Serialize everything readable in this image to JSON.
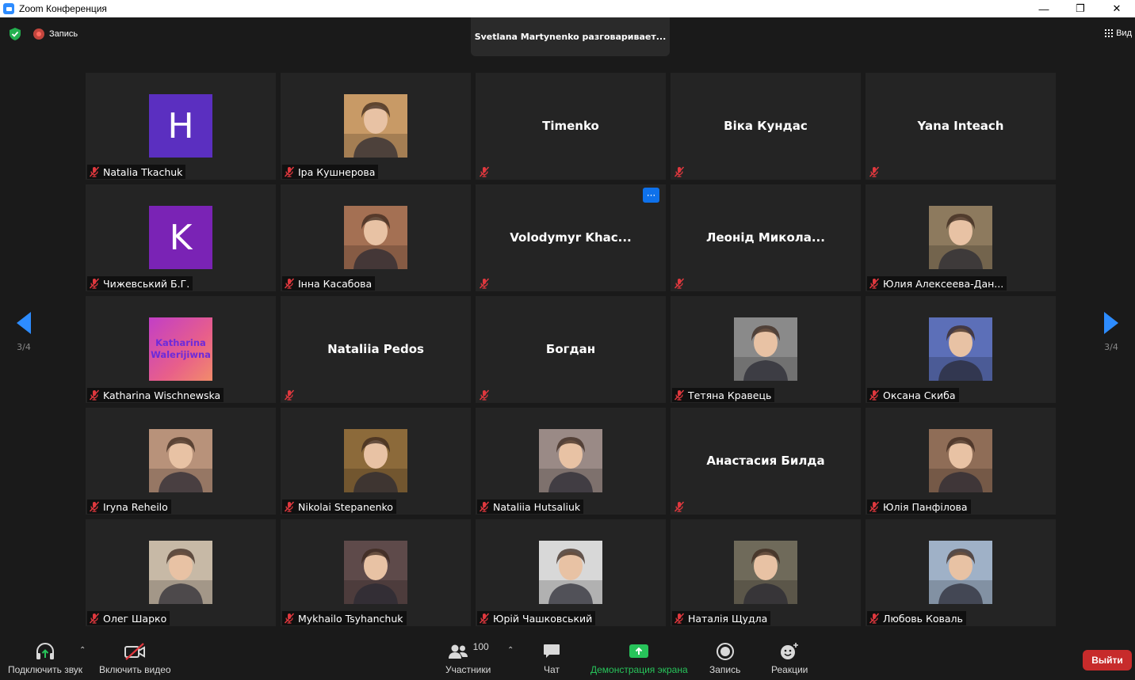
{
  "window": {
    "title": "Zoom Конференция",
    "minimize": "—",
    "restore": "❐",
    "close": "✕"
  },
  "top": {
    "recording_label": "Запись",
    "speaker_banner": "Svetlana Martynenko разговаривает...",
    "view_label": "Вид"
  },
  "pager": {
    "left": "3/4",
    "right": "3/4"
  },
  "participants": [
    {
      "name": "Natalia Tkachuk",
      "avatar": "letter",
      "letter": "H",
      "color": "#5b2fc0"
    },
    {
      "name": "Іра Кушнерова",
      "avatar": "photo",
      "color": "#c89a66"
    },
    {
      "name": "",
      "center": "Timenko"
    },
    {
      "name": "",
      "center": "Віка Кундас"
    },
    {
      "name": "",
      "center": "Yana Inteach"
    },
    {
      "name": "Чижевський Б.Г.",
      "avatar": "letter",
      "letter": "K",
      "color": "#7a23b5"
    },
    {
      "name": "Інна Касабова",
      "avatar": "photo",
      "color": "#a47053"
    },
    {
      "name": "",
      "center": "Volodymyr  Khac...",
      "menu": "···"
    },
    {
      "name": "",
      "center": "Леонід  Микола..."
    },
    {
      "name": "Юлия Алексеева-Дан...",
      "avatar": "photo",
      "color": "#8d7a5e"
    },
    {
      "name": "Katharina Wischnewska",
      "avatar": "text",
      "text1": "Katharina",
      "text2": "Walerijiwna"
    },
    {
      "name": "",
      "center": "Nataliia Pedos"
    },
    {
      "name": "",
      "center": "Богдан"
    },
    {
      "name": "Тетяна Кравець",
      "avatar": "photo",
      "color": "#8a8a8a"
    },
    {
      "name": "Оксана Скиба",
      "avatar": "photo",
      "color": "#5c6fb8"
    },
    {
      "name": "Iryna Reheilo",
      "avatar": "photo",
      "color": "#b8927a"
    },
    {
      "name": "Nikolai Stepanenko",
      "avatar": "photo",
      "color": "#8c6a3a"
    },
    {
      "name": "Nataliia Hutsaliuk",
      "avatar": "photo",
      "color": "#9a8a86"
    },
    {
      "name": "",
      "center": "Анастасия Билда"
    },
    {
      "name": "Юлія Панфілова",
      "avatar": "photo",
      "color": "#8f6d57"
    },
    {
      "name": "Олег Шарко",
      "avatar": "photo",
      "color": "#c7b9a6"
    },
    {
      "name": "Mykhailo Tsyhanchuk",
      "avatar": "photo",
      "color": "#5e4a4a"
    },
    {
      "name": "Юрій Чашковський",
      "avatar": "photo",
      "color": "#d8d8d8"
    },
    {
      "name": "Наталія Щудла",
      "avatar": "photo",
      "color": "#6f6a5a"
    },
    {
      "name": "Любовь Коваль",
      "avatar": "photo",
      "color": "#9fb1c7"
    }
  ],
  "toolbar": {
    "audio_label": "Подключить звук",
    "video_label": "Включить видео",
    "participants_label": "Участники",
    "participants_count": "100",
    "chat_label": "Чат",
    "share_label": "Демонстрация экрана",
    "record_label": "Запись",
    "reactions_label": "Реакции",
    "exit_label": "Выйти"
  },
  "colors": {
    "accent_blue": "#2d8cff",
    "share_green": "#27c35a",
    "exit_red": "#c72b2b",
    "mic_off_red": "#e0383e"
  }
}
